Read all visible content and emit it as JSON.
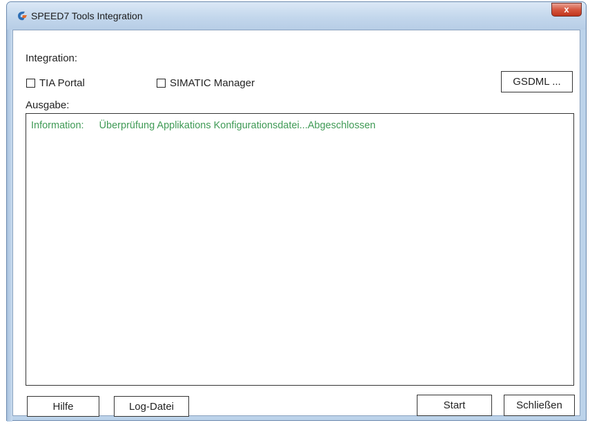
{
  "window": {
    "title": "SPEED7 Tools Integration",
    "close_label": "x"
  },
  "integration": {
    "label": "Integration:",
    "options": [
      {
        "label": "TIA Portal",
        "checked": false
      },
      {
        "label": "SIMATIC Manager",
        "checked": false
      }
    ],
    "gsdml_label": "GSDML ..."
  },
  "output": {
    "label": "Ausgabe:",
    "lines": [
      {
        "level": "Information:",
        "message": "Überprüfung Applikations Konfigurationsdatei...Abgeschlossen",
        "color": "#3f9a55"
      }
    ]
  },
  "footer": {
    "help_label": "Hilfe",
    "logfile_label": "Log-Datei",
    "start_label": "Start",
    "close_label": "Schließen"
  }
}
